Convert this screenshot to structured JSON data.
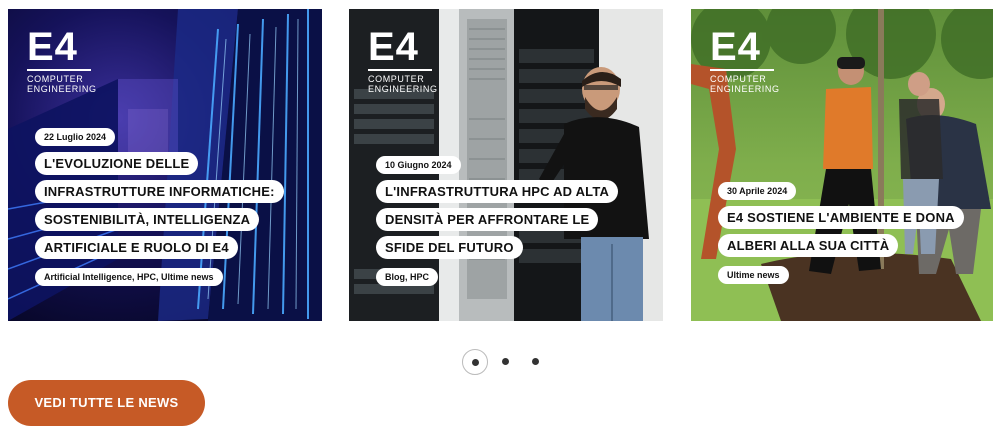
{
  "brand": {
    "logo_main": "E4",
    "logo_sub_line1": "COMPUTER",
    "logo_sub_line2": "ENGINEERING"
  },
  "cards": [
    {
      "date": "22 Luglio 2024",
      "title_lines": [
        "L'EVOLUZIONE DELLE",
        "INFRASTRUTTURE INFORMATICHE:",
        "SOSTENIBILITÀ, INTELLIGENZA",
        "ARTIFICIALE E RUOLO DI E4"
      ],
      "tags": "Artificial Intelligence, HPC, Ultime news"
    },
    {
      "date": "10 Giugno 2024",
      "title_lines": [
        "L'INFRASTRUTTURA HPC AD ALTA",
        "DENSITÀ PER AFFRONTARE LE",
        "SFIDE DEL FUTURO"
      ],
      "tags": "Blog, HPC"
    },
    {
      "date": "30 Aprile 2024",
      "title_lines": [
        "E4 SOSTIENE L'AMBIENTE E DONA",
        "ALBERI ALLA SUA CITTÀ"
      ],
      "tags": "Ultime news"
    }
  ],
  "carousel": {
    "pages": 3,
    "active": 1
  },
  "cta": {
    "all_news_label": "VEDI TUTTE LE NEWS"
  },
  "colors": {
    "accent": "#c65a26",
    "pill_bg": "#ffffff",
    "pill_text": "#111111"
  }
}
